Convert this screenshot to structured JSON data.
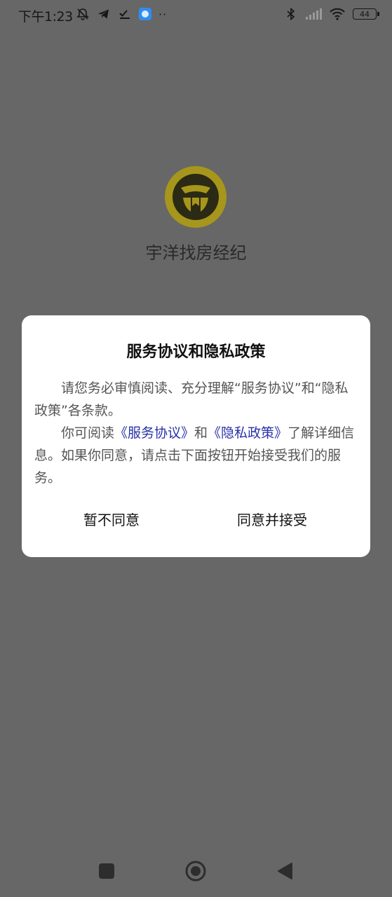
{
  "status_bar": {
    "time": "下午1:23",
    "battery_level": "44",
    "left_icons": [
      "mute-bell-icon",
      "telegram-icon",
      "check-list-icon",
      "app-notification-icon",
      "more-dots-icon"
    ],
    "right_icons": [
      "bluetooth-icon",
      "signal-icon",
      "wifi-icon",
      "battery-icon"
    ],
    "more_dots": "··"
  },
  "app": {
    "name": "宇洋找房经纪",
    "logo_color": "#2b2a14",
    "logo_ring": "#a7961c"
  },
  "dialog": {
    "title": "服务协议和隐私政策",
    "para1": "请您务必审慎阅读、充分理解“服务协议”和“隐私政策”各条款。",
    "para2_prefix": "你可阅读",
    "link_service": "《服务协议》",
    "para2_and": "和",
    "link_privacy": "《隐私政策》",
    "para2_suffix": "了解详细信息。如果你同意，请点击下面按钮开始接受我们的服务。",
    "decline_label": "暂不同意",
    "accept_label": "同意并接受",
    "link_color": "#2631a8"
  },
  "nav_bar": {
    "icons": [
      "recents-square-icon",
      "home-circle-icon",
      "back-triangle-icon"
    ]
  }
}
